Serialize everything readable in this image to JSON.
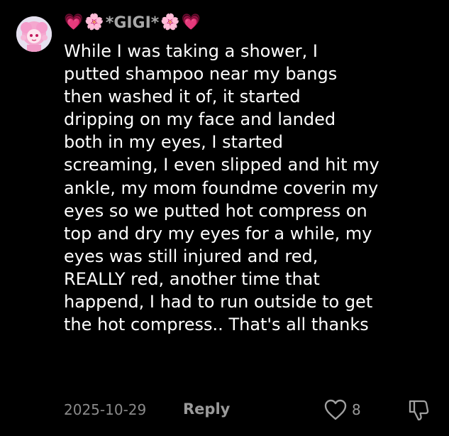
{
  "comment": {
    "username": {
      "prefix_emojis": [
        "💗",
        "🌸"
      ],
      "name": "*GIGI*",
      "suffix_emojis": [
        "🌸",
        "💗"
      ]
    },
    "avatar_icon": "anime-girl-avatar",
    "text": "While I was taking a shower, I\nputted shampoo near my bangs\nthen washed it of, it started\ndripping on my face and landed\nboth in my eyes, I started\nscreaming, I even slipped and hit my\nankle, my mom foundme coverin my\neyes so we putted hot compress on\ntop and dry my eyes for a while, my\neyes was  still injured and red,\nREALLY red, another time that\nhappend, I had to run outside to get\nthe hot compress.. That's all thanks",
    "date": "2025-10-29",
    "reply_label": "Reply",
    "like_icon": "heart-outline-icon",
    "like_count": "8",
    "dislike_icon": "thumbs-down-icon"
  },
  "colors": {
    "background": "#000000",
    "text": "#ffffff",
    "muted": "#8a8a8a",
    "accent_heart": "#d6336c"
  }
}
